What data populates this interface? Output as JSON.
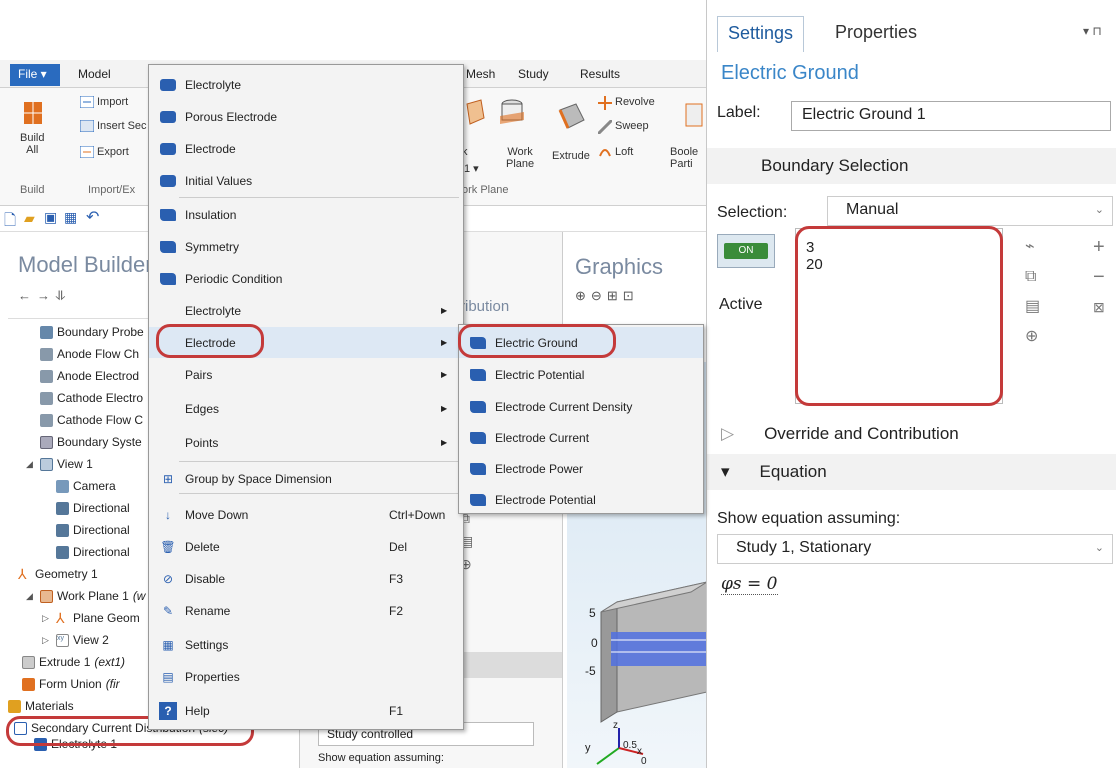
{
  "ribbon": {
    "tabs": [
      "File ▾",
      "Model",
      "Mesh",
      "Study",
      "Results"
    ],
    "import_label": "Import",
    "insert_label": "Insert Sec",
    "export_label": "Export",
    "build_label": "Build\nAll",
    "build_group": "Build",
    "import_group": "Import/Ex",
    "work_label": "Work\nPlane",
    "work_prefix": "k",
    "work_dropdown": "1 ▾",
    "work_group": "ork Plane",
    "extrude_label": "Extrude",
    "revolve_label": "Revolve",
    "sweep_label": "Sweep",
    "loft_label": "Loft",
    "boolean_label": "Boole\nParti"
  },
  "model_builder": {
    "title": "Model Builder",
    "tree": [
      {
        "label": "Boundary Probe",
        "italic": ""
      },
      {
        "label": "Anode Flow Ch",
        "italic": ""
      },
      {
        "label": "Anode Electrod",
        "italic": ""
      },
      {
        "label": "Cathode Electro",
        "italic": ""
      },
      {
        "label": "Cathode Flow C",
        "italic": ""
      },
      {
        "label": "Boundary Syste",
        "italic": ""
      },
      {
        "label": "View 1",
        "italic": ""
      },
      {
        "label": "Camera",
        "italic": ""
      },
      {
        "label": "Directional",
        "italic": ""
      },
      {
        "label": "Directional",
        "italic": ""
      },
      {
        "label": "Directional",
        "italic": ""
      },
      {
        "label": "Geometry 1",
        "italic": ""
      },
      {
        "label": "Work Plane 1",
        "italic": "(w"
      },
      {
        "label": "Plane Geom",
        "italic": ""
      },
      {
        "label": "View 2",
        "italic": ""
      },
      {
        "label": "Extrude 1",
        "italic": "(ext1)"
      },
      {
        "label": "Form Union",
        "italic": "(fir"
      },
      {
        "label": "Materials",
        "italic": ""
      },
      {
        "label": "Secondary Current Distribution",
        "italic": "(siec)"
      },
      {
        "label": "Electrolyte 1",
        "italic": ""
      }
    ]
  },
  "mid_pane": {
    "partial_title": "ribution",
    "study_controlled": "Study controlled",
    "show_eq_partial": "Show equation assuming:"
  },
  "graphics": {
    "title": "Graphics",
    "axis_ticks": [
      "5",
      "0",
      "-5"
    ],
    "axis_x": "x",
    "axis_y": "y",
    "axis_z": "z",
    "axis_small": "0.5",
    "axis_zero": "0"
  },
  "context_menu": {
    "items": [
      {
        "label": "Electrolyte",
        "icon": "blue-domain-icon",
        "short": "",
        "arrow": false
      },
      {
        "label": "Porous Electrode",
        "icon": "blue-domain-icon",
        "short": "",
        "arrow": false
      },
      {
        "label": "Electrode",
        "icon": "blue-domain-icon",
        "short": "",
        "arrow": false
      },
      {
        "label": "Initial Values",
        "icon": "blue-domain-icon",
        "short": "",
        "arrow": false
      },
      {
        "label": "Insulation",
        "icon": "blue-boundary-icon",
        "short": "",
        "arrow": false
      },
      {
        "label": "Symmetry",
        "icon": "blue-boundary-icon",
        "short": "",
        "arrow": false
      },
      {
        "label": "Periodic Condition",
        "icon": "blue-boundary-icon",
        "short": "",
        "arrow": false
      },
      {
        "label": "Electrolyte",
        "icon": "",
        "short": "",
        "arrow": true
      },
      {
        "label": "Electrode",
        "icon": "",
        "short": "",
        "arrow": true
      },
      {
        "label": "Pairs",
        "icon": "",
        "short": "",
        "arrow": true
      },
      {
        "label": "Edges",
        "icon": "",
        "short": "",
        "arrow": true
      },
      {
        "label": "Points",
        "icon": "",
        "short": "",
        "arrow": true
      },
      {
        "label": "Group by Space Dimension",
        "icon": "group-icon",
        "short": "",
        "arrow": false
      },
      {
        "label": "Move Down",
        "icon": "arrow-down-icon",
        "short": "Ctrl+Down",
        "arrow": false
      },
      {
        "label": "Delete",
        "icon": "trash-icon",
        "short": "Del",
        "arrow": false
      },
      {
        "label": "Disable",
        "icon": "disable-icon",
        "short": "F3",
        "arrow": false
      },
      {
        "label": "Rename",
        "icon": "rename-icon",
        "short": "F2",
        "arrow": false
      },
      {
        "label": "Settings",
        "icon": "settings-icon",
        "short": "",
        "arrow": false
      },
      {
        "label": "Properties",
        "icon": "properties-icon",
        "short": "",
        "arrow": false
      },
      {
        "label": "Help",
        "icon": "help-icon",
        "short": "F1",
        "arrow": false
      }
    ]
  },
  "sub_menu": {
    "items": [
      "Electric Ground",
      "Electric Potential",
      "Electrode Current Density",
      "Electrode Current",
      "Electrode Power",
      "Electrode Potential"
    ]
  },
  "settings": {
    "tab_settings": "Settings",
    "tab_properties": "Properties",
    "title": "Electric Ground",
    "label_caption": "Label:",
    "label_value": "Electric Ground 1",
    "boundary_selection": "Boundary Selection",
    "selection_caption": "Selection:",
    "selection_value": "Manual",
    "toggle_text": "ON",
    "active_label": "Active",
    "selected_boundaries": [
      "3",
      "20"
    ],
    "override_section": "Override and Contribution",
    "equation_section": "Equation",
    "show_eq": "Show equation assuming:",
    "study_value": "Study 1, Stationary",
    "equation": "φs = 0",
    "highlight_color": "#c43a3a",
    "accent_color": "#3a86c8"
  }
}
